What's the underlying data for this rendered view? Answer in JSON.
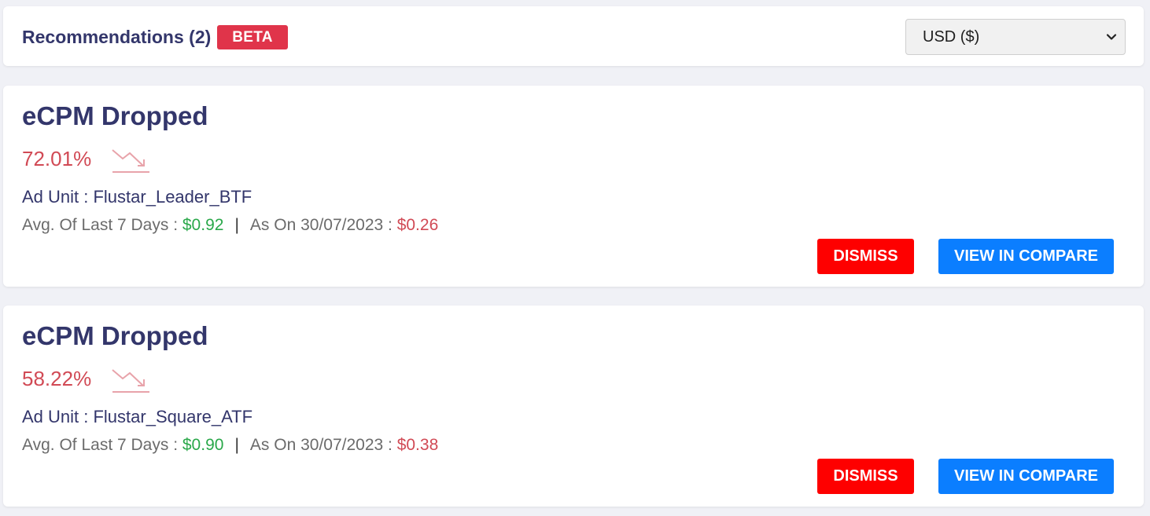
{
  "header": {
    "title": "Recommendations (2)",
    "badge": "BETA",
    "currency": {
      "selected": "USD ($)",
      "icon": "chevron-down-icon"
    }
  },
  "recommendations": [
    {
      "title": "eCPM Dropped",
      "percent": "72.01%",
      "trend_icon": "trend-down-icon",
      "ad_unit": "Ad Unit : Flustar_Leader_BTF",
      "avg_label": "Avg. Of Last 7 Days : ",
      "avg_value": "$0.92",
      "separator": "|",
      "as_on_label": "As On 30/07/2023 : ",
      "as_on_value": "$0.26",
      "dismiss_label": "DISMISS",
      "compare_label": "VIEW IN COMPARE"
    },
    {
      "title": "eCPM Dropped",
      "percent": "58.22%",
      "trend_icon": "trend-down-icon",
      "ad_unit": "Ad Unit : Flustar_Square_ATF",
      "avg_label": "Avg. Of Last 7 Days : ",
      "avg_value": "$0.90",
      "separator": "|",
      "as_on_label": "As On 30/07/2023 : ",
      "as_on_value": "$0.38",
      "dismiss_label": "DISMISS",
      "compare_label": "VIEW IN COMPARE"
    }
  ],
  "colors": {
    "title": "#33366b",
    "beta": "#e0344a",
    "negative": "#d14a55",
    "positive": "#2aa84a",
    "dismiss": "#fe0000",
    "compare": "#0b7eff"
  }
}
